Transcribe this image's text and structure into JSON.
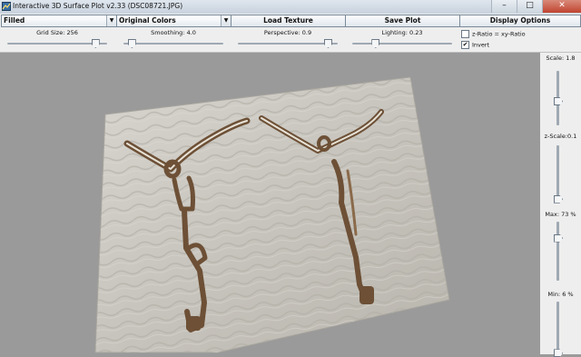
{
  "window": {
    "title": "Interactive 3D Surface Plot v2.33  (DSC08721.JPG)",
    "minimize": "–",
    "maximize": "□",
    "close": "✕"
  },
  "toolbar": {
    "plot_mode": "Filled",
    "color_mode": "Original Colors",
    "load_texture": "Load Texture",
    "save_plot": "Save Plot",
    "display_options": "Display Options"
  },
  "sliders": {
    "grid_size": {
      "label": "Grid Size: 256",
      "level": 0.88
    },
    "smoothing": {
      "label": "Smoothing: 4.0",
      "level": 0.08
    },
    "perspective": {
      "label": "Perspective: 0.9",
      "level": 0.9
    },
    "lighting": {
      "label": "Lighting: 0.23",
      "level": 0.23
    }
  },
  "options": {
    "z_ratio": {
      "label": "z-Ratio = xy-Ratio",
      "checked": false
    },
    "invert": {
      "label": "Invert",
      "checked": true
    }
  },
  "right_panel": {
    "scale": {
      "label": "Scale: 1.8",
      "level": 0.45
    },
    "z_scale": {
      "label": "z-Scale:0.1",
      "level": 0.02
    },
    "max": {
      "label": "Max: 73 %",
      "level": 0.73
    },
    "min": {
      "label": "Min: 6 %",
      "level": 0.06
    }
  },
  "colors": {
    "window_bg": "#eeeeee",
    "plot_bg": "#9a9a9a",
    "cloth": "#c9c6bf",
    "figure": "#7a5a3c"
  }
}
